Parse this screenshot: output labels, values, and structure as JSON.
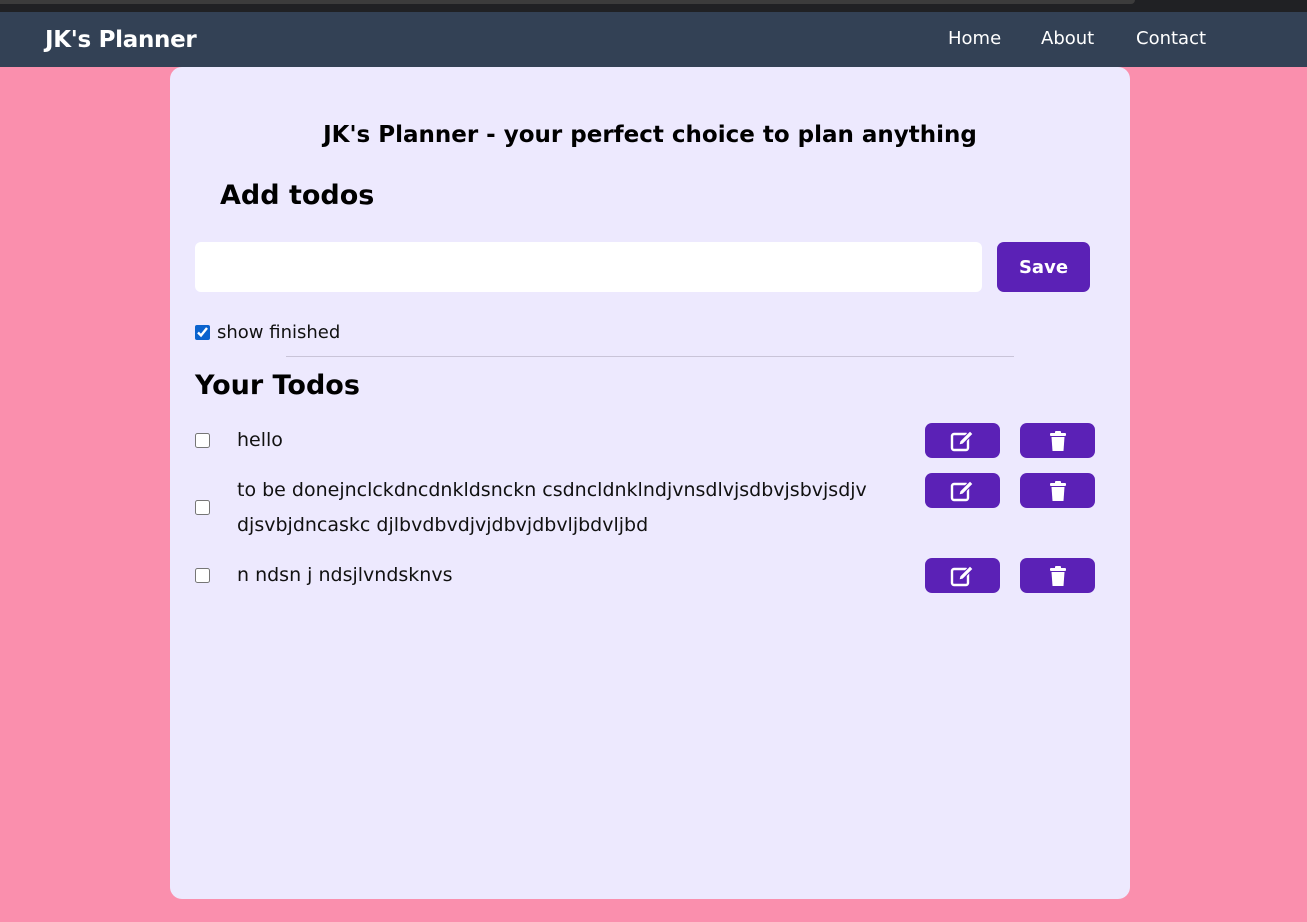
{
  "navbar": {
    "brand": "JK's Planner",
    "links": [
      "Home",
      "About",
      "Contact"
    ]
  },
  "main": {
    "headline": "JK's Planner - your perfect choice to plan anything",
    "add_heading": "Add todos",
    "input_value": "",
    "save_label": "Save",
    "show_finished_label": "show finished",
    "show_finished_checked": true,
    "todos_heading": "Your Todos",
    "todos": [
      {
        "text": "hello",
        "done": false
      },
      {
        "text": "to be donejnclckdncdnkldsnckn csdncldnklndjvnsdlvjsdbvjsbvjsdjv djsvbjdncaskc djlbvdbvdjvjdbvjdbvljbdvljbd",
        "done": false
      },
      {
        "text": "n ndsn j ndsjlvndsknvs",
        "done": false
      }
    ],
    "row_icons": {
      "edit": "edit-icon",
      "delete": "trash-icon"
    }
  },
  "colors": {
    "page_bg": "#fa8fad",
    "navbar_bg": "#334155",
    "card_bg": "#ede9fe",
    "button_bg": "#5b21b6"
  }
}
